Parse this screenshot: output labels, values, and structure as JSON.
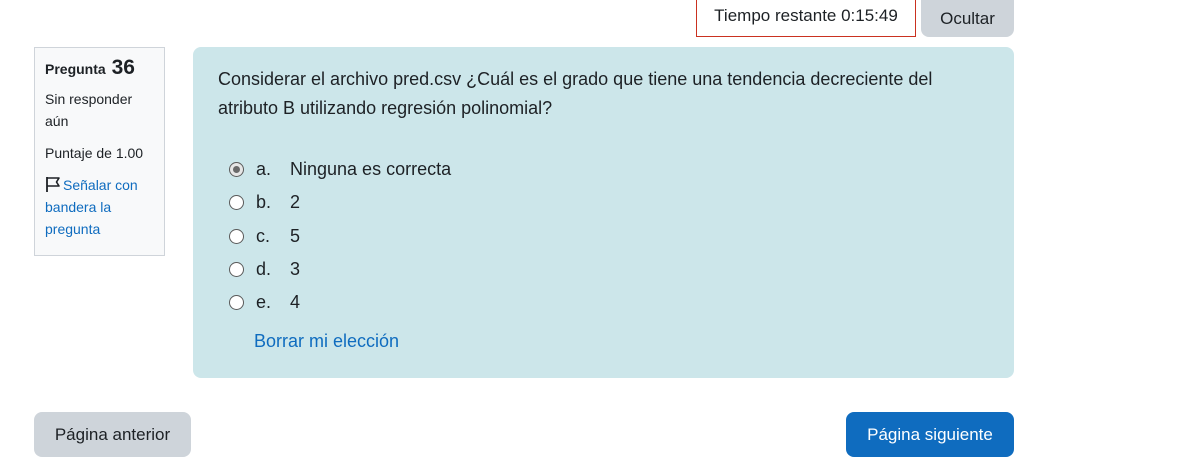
{
  "timer": {
    "label": "Tiempo restante 0:15:49",
    "hide_label": "Ocultar"
  },
  "info": {
    "question_label": "Pregunta",
    "question_number": "36",
    "state": "Sin responder aún",
    "grade": "Puntaje de 1.00",
    "flag_label": "Señalar con bandera la pregunta"
  },
  "question": {
    "text": "Considerar el archivo pred.csv ¿Cuál es el grado que tiene una tendencia decreciente del atributo B utilizando regresión polinomial?",
    "answers": [
      {
        "letter": "a.",
        "text": "Ninguna es correcta",
        "selected": true
      },
      {
        "letter": "b.",
        "text": "2",
        "selected": false
      },
      {
        "letter": "c.",
        "text": "5",
        "selected": false
      },
      {
        "letter": "d.",
        "text": "3",
        "selected": false
      },
      {
        "letter": "e.",
        "text": "4",
        "selected": false
      }
    ],
    "clear_label": "Borrar mi elección"
  },
  "nav": {
    "prev_label": "Página anterior",
    "next_label": "Página siguiente"
  },
  "colors": {
    "accent": "#0f6cbf",
    "content_bg": "#cce6ea",
    "timer_border": "#ca3120",
    "secondary_btn": "#ced4da"
  }
}
